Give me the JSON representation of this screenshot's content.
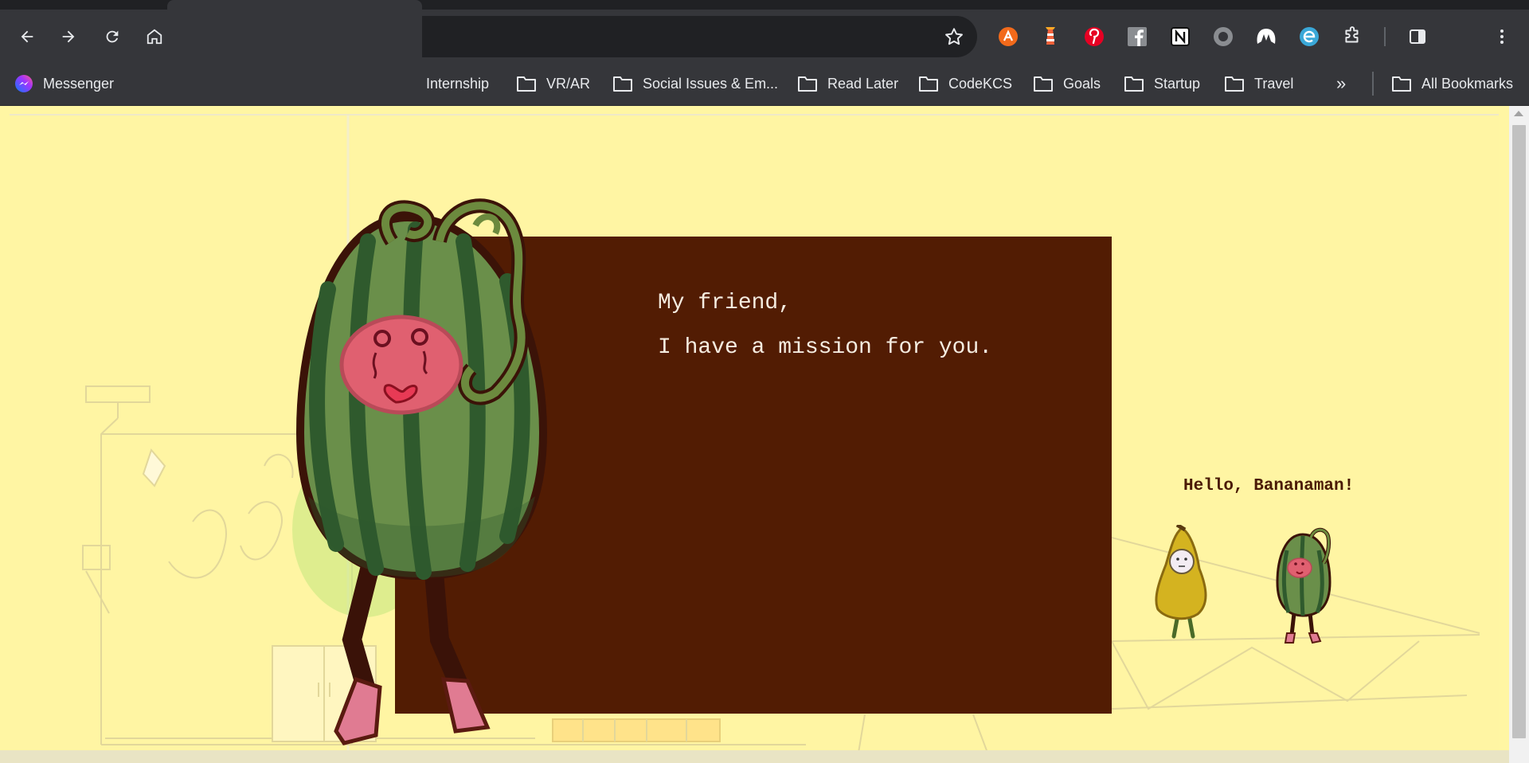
{
  "browser": {
    "omnibox_url": "",
    "bookmarks": [
      {
        "label": "Messenger",
        "icon": "messenger-icon"
      },
      {
        "label": "Internship",
        "icon": ""
      },
      {
        "label": "VR/AR",
        "icon": "folder-icon"
      },
      {
        "label": "Social Issues & Em...",
        "icon": "folder-icon"
      },
      {
        "label": "Read Later",
        "icon": "folder-icon"
      },
      {
        "label": "CodeKCS",
        "icon": "folder-icon"
      },
      {
        "label": "Goals",
        "icon": "folder-icon"
      },
      {
        "label": "Startup",
        "icon": "folder-icon"
      },
      {
        "label": "Travel",
        "icon": "folder-icon"
      }
    ],
    "overflow_label": "»",
    "all_bookmarks_label": "All Bookmarks",
    "extensions": [
      "avast-icon",
      "lighthouse-icon",
      "pinterest-icon",
      "facebook-icon",
      "notion-icon",
      "record-icon",
      "malwarebytes-icon",
      "edge-icon",
      "puzzle-icon"
    ]
  },
  "game": {
    "dialog": {
      "line1": "My friend,",
      "line2": "I have a mission for you."
    },
    "speech_bubble": "Hello, Bananaman!",
    "colors": {
      "background": "#fff5a3",
      "dialog_box": "#521c03",
      "dialog_text": "#f5ece0",
      "watermelon_dark": "#2f5a2d",
      "watermelon_light": "#6a8f4a",
      "face": "#e06070",
      "banana": "#d4b320"
    }
  }
}
